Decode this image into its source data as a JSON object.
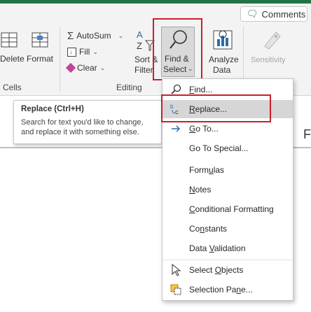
{
  "comments_button": {
    "label": "Comments",
    "icon": "comment-icon"
  },
  "ribbon": {
    "delete_label": "Delete",
    "format_label": "Format",
    "cells_group": "Cells",
    "autosum_label": "AutoSum",
    "fill_label": "Fill",
    "clear_label": "Clear",
    "sort_label_1": "Sort &",
    "sort_label_2": "Filter",
    "find_select_1": "Find &",
    "find_select_2": "Select",
    "analyze_1": "Analyze",
    "analyze_2": "Data",
    "sensitivity_label": "Sensitivity",
    "editing_group": "Editing"
  },
  "tooltip": {
    "title": "Replace (Ctrl+H)",
    "description_line1": "Search for text you'd like to change,",
    "description_line2": "and replace it with something else."
  },
  "menu": {
    "items": [
      {
        "label": "Find...",
        "icon": "search-icon"
      },
      {
        "label": "Replace...",
        "icon": "replace-icon"
      },
      {
        "label": "Go To...",
        "icon": "arrow-right-icon"
      },
      {
        "label": "Go To Special...",
        "icon": ""
      },
      {
        "label": "Formulas",
        "icon": ""
      },
      {
        "label": "Notes",
        "icon": ""
      },
      {
        "label": "Conditional Formatting",
        "icon": ""
      },
      {
        "label": "Constants",
        "icon": ""
      },
      {
        "label": "Data Validation",
        "icon": ""
      },
      {
        "label": "Select Objects",
        "icon": "cursor-icon"
      },
      {
        "label": "Selection Pane...",
        "icon": "selection-pane-icon"
      }
    ]
  },
  "colors": {
    "accent": "#217346",
    "highlight_box": "#c8202a",
    "hover": "#d6d6d6"
  }
}
